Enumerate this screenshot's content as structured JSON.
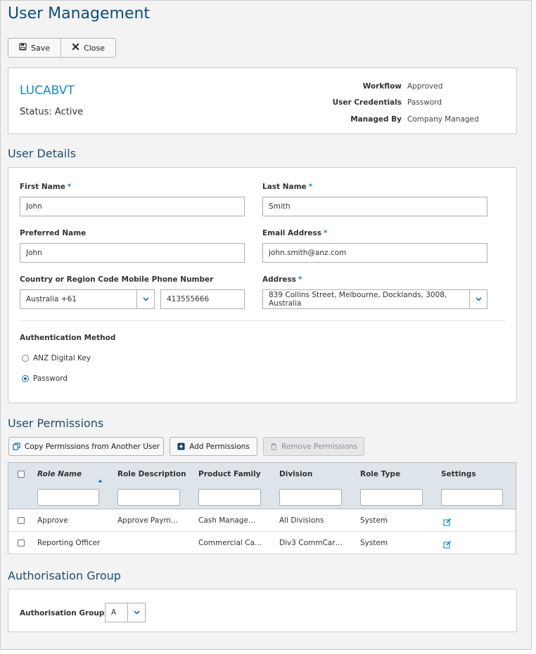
{
  "page": {
    "title": "User Management"
  },
  "toolbar": {
    "save_label": "Save",
    "close_label": "Close"
  },
  "summary": {
    "user_id": "LUCABVT",
    "status": "Status: Active",
    "meta": [
      {
        "label": "Workflow",
        "value": "Approved"
      },
      {
        "label": "User Credentials",
        "value": "Password"
      },
      {
        "label": "Managed By",
        "value": "Company Managed"
      }
    ]
  },
  "user_details": {
    "section_title": "User Details",
    "first_name": {
      "label": "First Name",
      "required": "*",
      "value": "John"
    },
    "last_name": {
      "label": "Last Name",
      "required": "*",
      "value": "Smith"
    },
    "preferred_name": {
      "label": "Preferred Name",
      "value": "John"
    },
    "email": {
      "label": "Email Address",
      "required": "*",
      "value": "john.smith@anz.com"
    },
    "phone": {
      "label": "Country or Region Code Mobile Phone Number",
      "country_value": "Australia +61",
      "number_value": "413555666"
    },
    "address": {
      "label": "Address",
      "required": "*",
      "value": "839 Collins Street, Melbourne, Docklands, 3008, Australia"
    },
    "auth": {
      "label": "Authentication Method",
      "options": [
        {
          "label": "ANZ Digital Key",
          "selected": false
        },
        {
          "label": "Password",
          "selected": true
        }
      ]
    }
  },
  "permissions": {
    "section_title": "User Permissions",
    "copy_label": "Copy Permissions from Another User",
    "add_label": "Add Permissions",
    "remove_label": "Remove Permissions",
    "columns": [
      "Role Name",
      "Role Description",
      "Product Family",
      "Division",
      "Role Type",
      "Settings"
    ],
    "rows": [
      [
        "Approve",
        "Approve Paym…",
        "Cash Manage…",
        "All Divisions",
        "System"
      ],
      [
        "Reporting Officer",
        "",
        "Commercial Ca…",
        "Div3 CommCar…",
        "System"
      ]
    ]
  },
  "auth_group": {
    "section_title": "Authorisation Group",
    "label": "Authorisation Group",
    "value": "A"
  },
  "colors": {
    "accent": "#1a87c6",
    "title": "#0d4d76",
    "grid_header": "#dde4ea"
  }
}
